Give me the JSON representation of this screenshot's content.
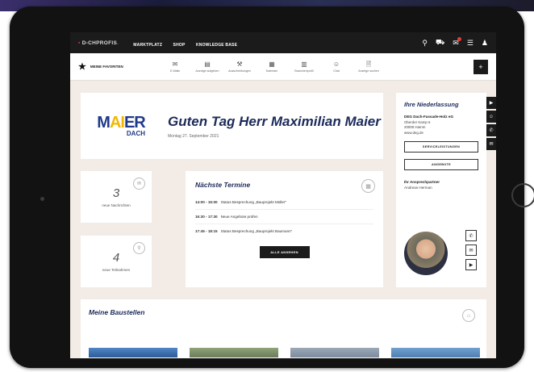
{
  "topbar": {
    "logo": "D-CHPROFIS",
    "nav": [
      "MARKTPLATZ",
      "SHOP",
      "KNOWLEDGE BASE"
    ],
    "icons": [
      "search-icon",
      "cart-icon",
      "notification-icon",
      "mail-icon",
      "user-icon"
    ]
  },
  "shortcutbar": {
    "favorites_label": "MEINE FAVORITEN",
    "shortcuts": [
      {
        "label": "E-Mails",
        "icon": "✉"
      },
      {
        "label": "Anzeige aufgeben",
        "icon": "▤"
      },
      {
        "label": "Ausschreibungen",
        "icon": "⚒"
      },
      {
        "label": "Kalender",
        "icon": "▦"
      },
      {
        "label": "Branchenprofil",
        "icon": "▥"
      },
      {
        "label": "Chat",
        "icon": "☺"
      },
      {
        "label": "Anzeige suchen",
        "icon": "🗎"
      }
    ],
    "add_label": "+"
  },
  "greeting": {
    "logo_main": "MAIER",
    "logo_sub": "DACH",
    "title": "Guten Tag Herr Maximilian Maier",
    "date": "Montag 27. September 2021"
  },
  "stats": [
    {
      "value": "3",
      "label": "neue Nachrichten"
    },
    {
      "value": "4",
      "label": "neue Teilnahmen"
    }
  ],
  "appointments": {
    "title": "Nächste Termine",
    "items": [
      {
        "time": "14:00 - 15:00",
        "text": "Status Besprechung „Bauprojekt Müller“"
      },
      {
        "time": "16:30 - 17:30",
        "text": "Neue Angebote prüfen"
      },
      {
        "time": "17:45 - 18:15",
        "text": "Status Besprechung „Bauprojekt Baumann“"
      }
    ],
    "button": "ALLE ANSEHEN"
  },
  "branch": {
    "title": "Ihre Niederlassung",
    "name": "DEG Dach-Fassade-Holz eG",
    "street": "Oberder Kamp 6",
    "city": "20000 Hamm",
    "web": "www.deg.de",
    "button1": "SERVICELEISTUNGEN",
    "button2": "ANGEBOTE",
    "contact_label": "Ihr Ansprechpartner",
    "contact_name": "Andreas Herman"
  },
  "sites": {
    "title": "Meine Baustellen"
  }
}
